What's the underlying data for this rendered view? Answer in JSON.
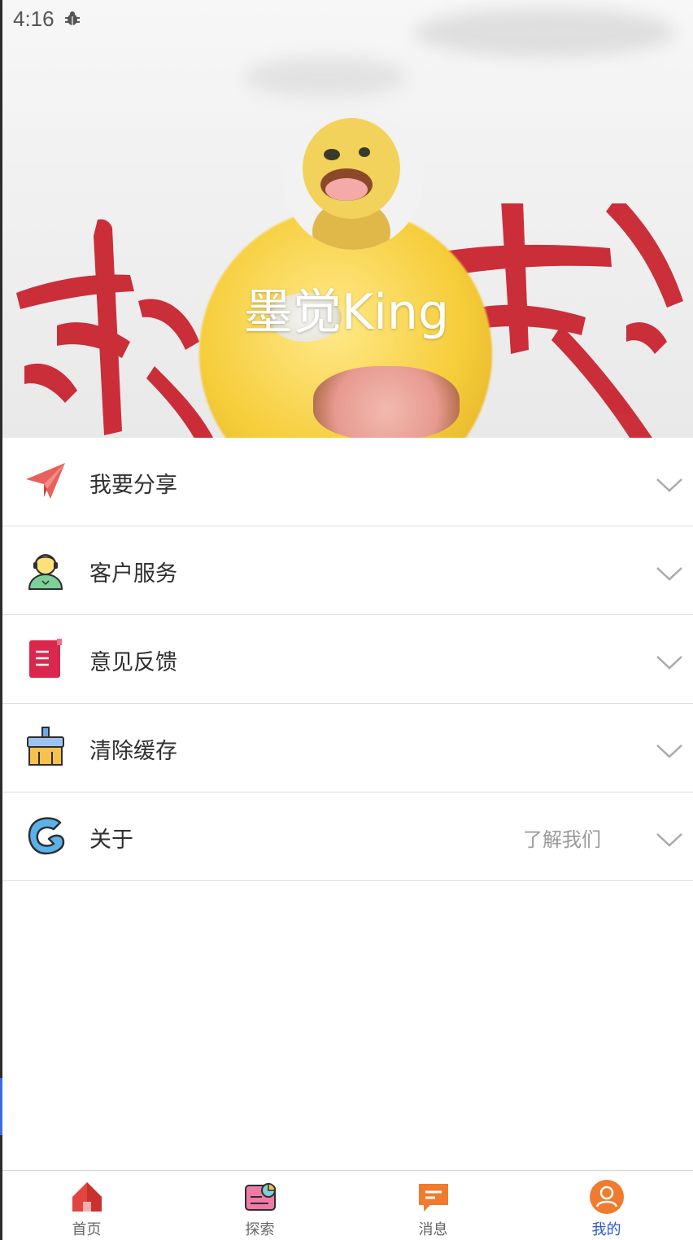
{
  "status_bar": {
    "time": "4:16",
    "icon": "bug-icon"
  },
  "profile": {
    "username": "墨觉King",
    "avatar_icon": "avatar-mascot"
  },
  "menu": {
    "items": [
      {
        "label": "我要分享",
        "icon": "paper-plane-icon",
        "extra": ""
      },
      {
        "label": "客户服务",
        "icon": "customer-service-icon",
        "extra": ""
      },
      {
        "label": "意见反馈",
        "icon": "feedback-book-icon",
        "extra": ""
      },
      {
        "label": "清除缓存",
        "icon": "broom-clean-icon",
        "extra": ""
      },
      {
        "label": "关于",
        "icon": "about-logo-icon",
        "extra": "了解我们"
      }
    ]
  },
  "bottom_nav": {
    "items": [
      {
        "label": "首页",
        "icon": "home-icon",
        "active": false
      },
      {
        "label": "探索",
        "icon": "explore-icon",
        "active": false
      },
      {
        "label": "消息",
        "icon": "message-icon",
        "active": false
      },
      {
        "label": "我的",
        "icon": "profile-icon",
        "active": true
      }
    ]
  },
  "colors": {
    "accent": "#2a58d6",
    "calligraphy_red": "#c81e2a",
    "share_red": "#e8605c",
    "feedback_red": "#d9274d",
    "nav_orange": "#f07a2e"
  }
}
